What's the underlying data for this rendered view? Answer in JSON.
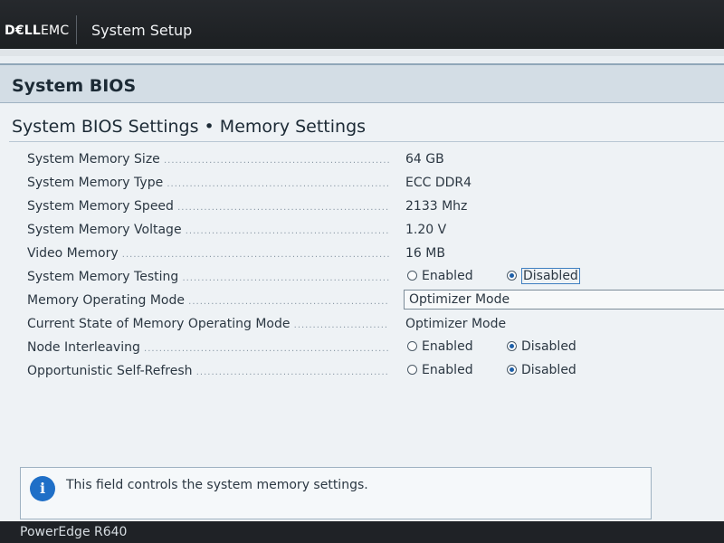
{
  "header": {
    "brand_dell": "D€LL",
    "brand_emc": "EMC",
    "app_title": "System Setup"
  },
  "section": {
    "title": "System BIOS"
  },
  "page": {
    "title": "System BIOS Settings • Memory Settings"
  },
  "settings": {
    "memory_size": {
      "label": "System Memory Size",
      "value": "64 GB"
    },
    "memory_type": {
      "label": "System Memory Type",
      "value": "ECC DDR4"
    },
    "memory_speed": {
      "label": "System Memory Speed",
      "value": "2133 Mhz"
    },
    "memory_voltage": {
      "label": "System Memory Voltage",
      "value": "1.20 V"
    },
    "video_memory": {
      "label": "Video Memory",
      "value": "16 MB"
    },
    "memory_testing": {
      "label": "System Memory Testing",
      "options": [
        "Enabled",
        "Disabled"
      ],
      "selected": "Disabled"
    },
    "operating_mode": {
      "label": "Memory Operating Mode",
      "value": "Optimizer Mode"
    },
    "current_mode": {
      "label": "Current State of Memory Operating Mode",
      "value": "Optimizer Mode"
    },
    "node_interleaving": {
      "label": "Node Interleaving",
      "options": [
        "Enabled",
        "Disabled"
      ],
      "selected": "Disabled"
    },
    "self_refresh": {
      "label": "Opportunistic Self-Refresh",
      "options": [
        "Enabled",
        "Disabled"
      ],
      "selected": "Disabled"
    }
  },
  "help": {
    "icon": "info-icon",
    "text": "This field controls the system memory settings."
  },
  "footer": {
    "model": "PowerEdge R640"
  },
  "colors": {
    "header_bg": "#1c1f22",
    "accent": "#1f6fc7",
    "panel_bg": "#eef2f5"
  }
}
